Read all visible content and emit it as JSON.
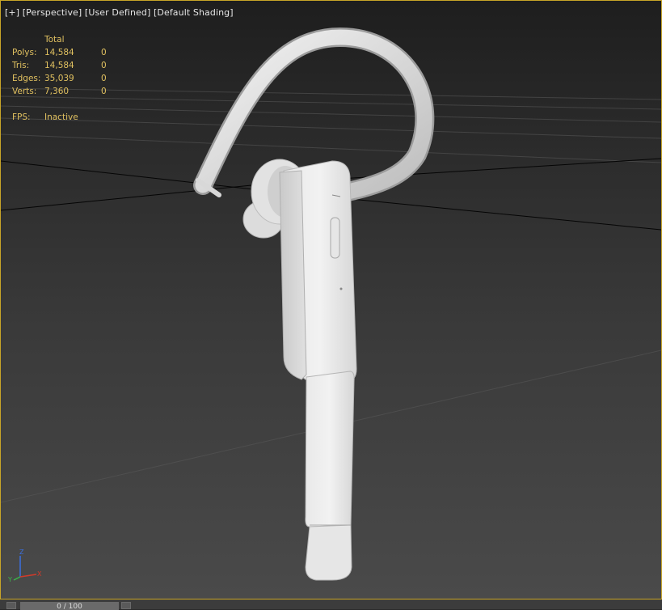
{
  "viewport": {
    "label_plus": "[+]",
    "label_view": "[Perspective]",
    "label_mode": "[User Defined]",
    "label_shading": "[Default Shading]"
  },
  "stats": {
    "total_header": "Total",
    "rows": [
      {
        "label": "Polys:",
        "total": "14,584",
        "selected": "0"
      },
      {
        "label": "Tris:",
        "total": "14,584",
        "selected": "0"
      },
      {
        "label": "Edges:",
        "total": "35,039",
        "selected": "0"
      },
      {
        "label": "Verts:",
        "total": "7,360",
        "selected": "0"
      }
    ],
    "fps_label": "FPS:",
    "fps_value": "Inactive"
  },
  "gizmo": {
    "x": "X",
    "y": "Y",
    "z": "Z"
  },
  "timeline": {
    "frame_text": "0 / 100"
  },
  "colors": {
    "active_border": "#c8a528",
    "stats_text": "#e0c060",
    "axis_x": "#d23a2a",
    "axis_y": "#3ab54a",
    "axis_z": "#3a6fe0"
  }
}
